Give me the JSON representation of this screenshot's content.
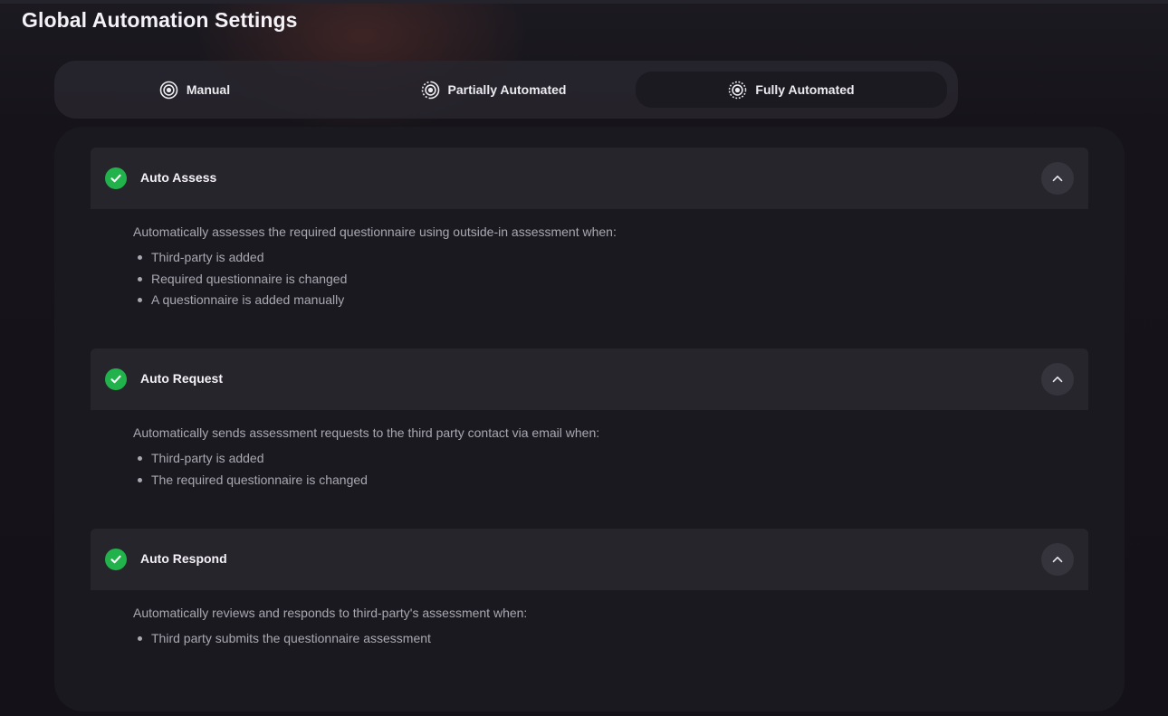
{
  "page": {
    "title": "Global Automation Settings"
  },
  "mode_switch": {
    "selected": "Fully Automated",
    "tabs": [
      {
        "label": "Manual",
        "icon": "radio-target-icon"
      },
      {
        "label": "Partially Automated",
        "icon": "partial-target-icon"
      },
      {
        "label": "Fully Automated",
        "icon": "dotted-target-icon"
      }
    ]
  },
  "sections": [
    {
      "title": "Auto Assess",
      "enabled": true,
      "expanded": true,
      "description": "Automatically assesses the required questionnaire using outside-in assessment when:",
      "items": [
        "Third-party is added",
        "Required questionnaire is changed",
        "A questionnaire is added manually"
      ]
    },
    {
      "title": "Auto Request",
      "enabled": true,
      "expanded": true,
      "description": "Automatically sends assessment requests to the third party contact via email when:",
      "items": [
        "Third-party is added",
        "The required questionnaire is changed"
      ]
    },
    {
      "title": "Auto Respond",
      "enabled": true,
      "expanded": true,
      "description": "Automatically reviews and responds to third-party's assessment when:",
      "items": [
        "Third party submits the questionnaire assessment"
      ]
    }
  ],
  "colors": {
    "background": "#15131a",
    "panel": "#1b1920",
    "section_header": "#27252c",
    "success_green": "#22b24c",
    "text_primary": "#f4f2f7",
    "text_secondary": "#a9a7b0"
  }
}
